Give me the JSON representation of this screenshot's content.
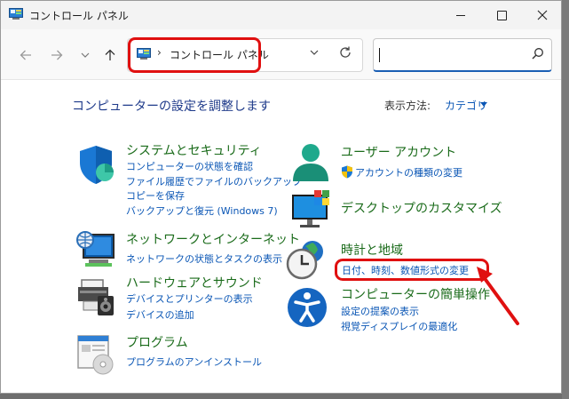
{
  "window": {
    "title": "コントロール パネル",
    "accent_color": "#0a56b5",
    "category_title_color": "#1a6b1a",
    "highlight_color": "#e01010"
  },
  "navigation": {
    "back_icon": "arrow-left-icon",
    "forward_icon": "arrow-right-icon",
    "recent_icon": "chevron-down-icon",
    "up_icon": "arrow-up-icon",
    "address_separator": "›",
    "address_path": "コントロール パネル",
    "search_placeholder": ""
  },
  "main": {
    "heading": "コンピューターの設定を調整します",
    "view_label": "表示方法:",
    "view_value": "カテゴリ"
  },
  "categories": [
    {
      "icon": "shield-icon",
      "title": "システムとセキュリティ",
      "links": [
        "コンピューターの状態を確認",
        "ファイル履歴でファイルのバックアップ",
        "コピーを保存",
        "バックアップと復元 (Windows 7)"
      ]
    },
    {
      "icon": "network-globe-icon",
      "title": "ネットワークとインターネット",
      "links": [
        "ネットワークの状態とタスクの表示"
      ]
    },
    {
      "icon": "printer-icon",
      "title": "ハードウェアとサウンド",
      "links": [
        "デバイスとプリンターの表示",
        "デバイスの追加"
      ]
    },
    {
      "icon": "programs-icon",
      "title": "プログラム",
      "links": [
        "プログラムのアンインストール"
      ]
    },
    {
      "icon": "user-icon",
      "title": "ユーザー アカウント",
      "links": [
        "アカウントの種類の変更"
      ]
    },
    {
      "icon": "monitor-icon",
      "title": "デスクトップのカスタマイズ",
      "links": []
    },
    {
      "icon": "clock-globe-icon",
      "title": "時計と地域",
      "links": [
        "日付、時刻、数値形式の変更"
      ]
    },
    {
      "icon": "accessibility-icon",
      "title": "コンピューターの簡単操作",
      "links": [
        "設定の提案の表示",
        "視覚ディスプレイの最適化"
      ]
    }
  ]
}
